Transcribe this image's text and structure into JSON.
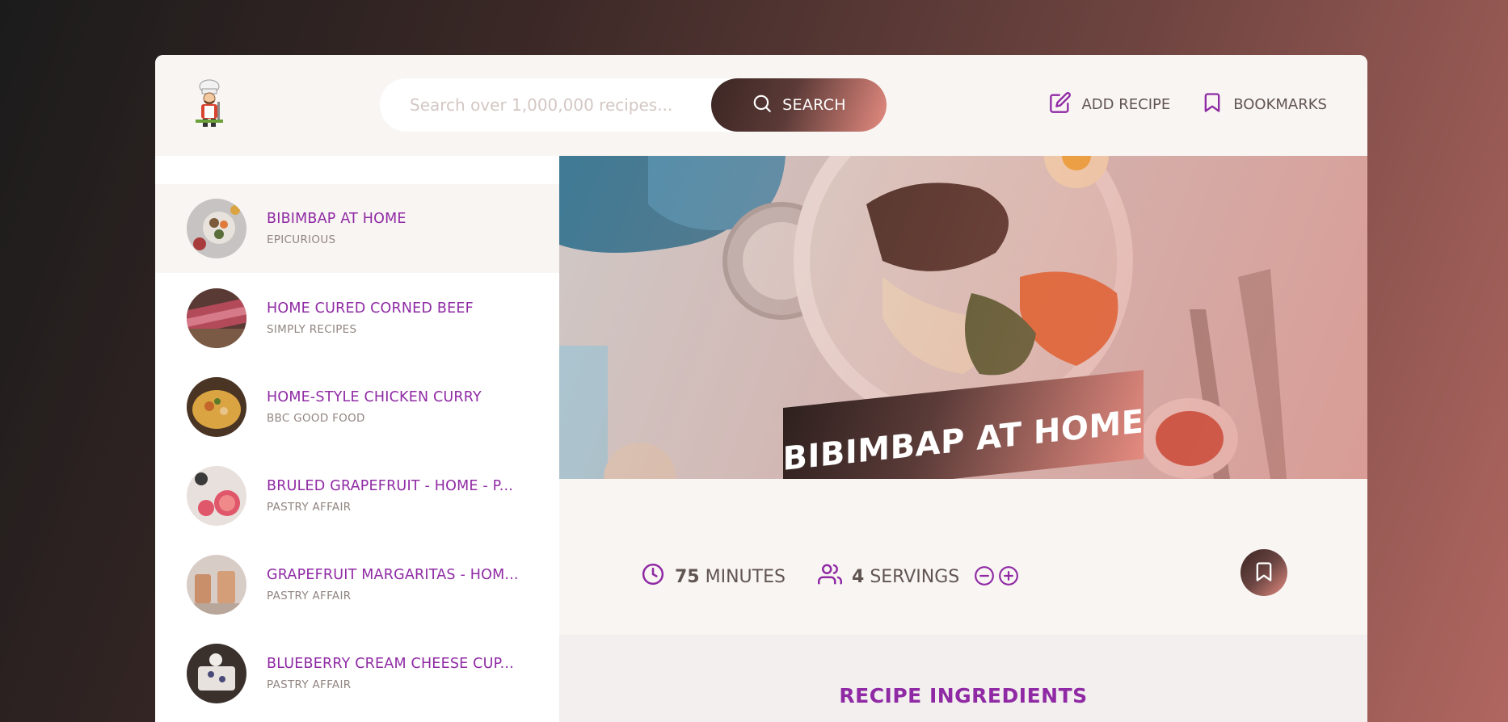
{
  "search": {
    "placeholder": "Search over 1,000,000 recipes...",
    "button_label": "SEARCH"
  },
  "nav": {
    "add_recipe": "ADD RECIPE",
    "bookmarks": "BOOKMARKS"
  },
  "results": [
    {
      "title": "BIBIMBAP AT HOME",
      "publisher": "EPICURIOUS",
      "active": true
    },
    {
      "title": "HOME CURED CORNED BEEF",
      "publisher": "SIMPLY RECIPES",
      "active": false
    },
    {
      "title": "HOME-STYLE CHICKEN CURRY",
      "publisher": "BBC GOOD FOOD",
      "active": false
    },
    {
      "title": "BRULED GRAPEFRUIT - HOME - P...",
      "publisher": "PASTRY AFFAIR",
      "active": false
    },
    {
      "title": "GRAPEFRUIT MARGARITAS - HOM...",
      "publisher": "PASTRY AFFAIR",
      "active": false
    },
    {
      "title": "BLUEBERRY CREAM CHEESE CUP...",
      "publisher": "PASTRY AFFAIR",
      "active": false
    }
  ],
  "recipe": {
    "title": "BIBIMBAP AT HOME",
    "minutes": "75",
    "minutes_label": "MINUTES",
    "servings": "4",
    "servings_label": "SERVINGS"
  },
  "ingredients": {
    "heading": "RECIPE INGREDIENTS"
  },
  "colors": {
    "accent": "#8f2aa4",
    "text": "#615551",
    "gradient_start": "#3b2623",
    "gradient_end": "#e58b80",
    "header_bg": "#f9f5f3"
  },
  "icons": {
    "search_button": "search-icon",
    "add_recipe": "edit-icon",
    "bookmarks": "bookmark-icon",
    "time": "clock-icon",
    "servings": "users-icon",
    "decrease": "minus-circle-icon",
    "increase": "plus-circle-icon",
    "bookmark_action": "bookmark-icon"
  }
}
